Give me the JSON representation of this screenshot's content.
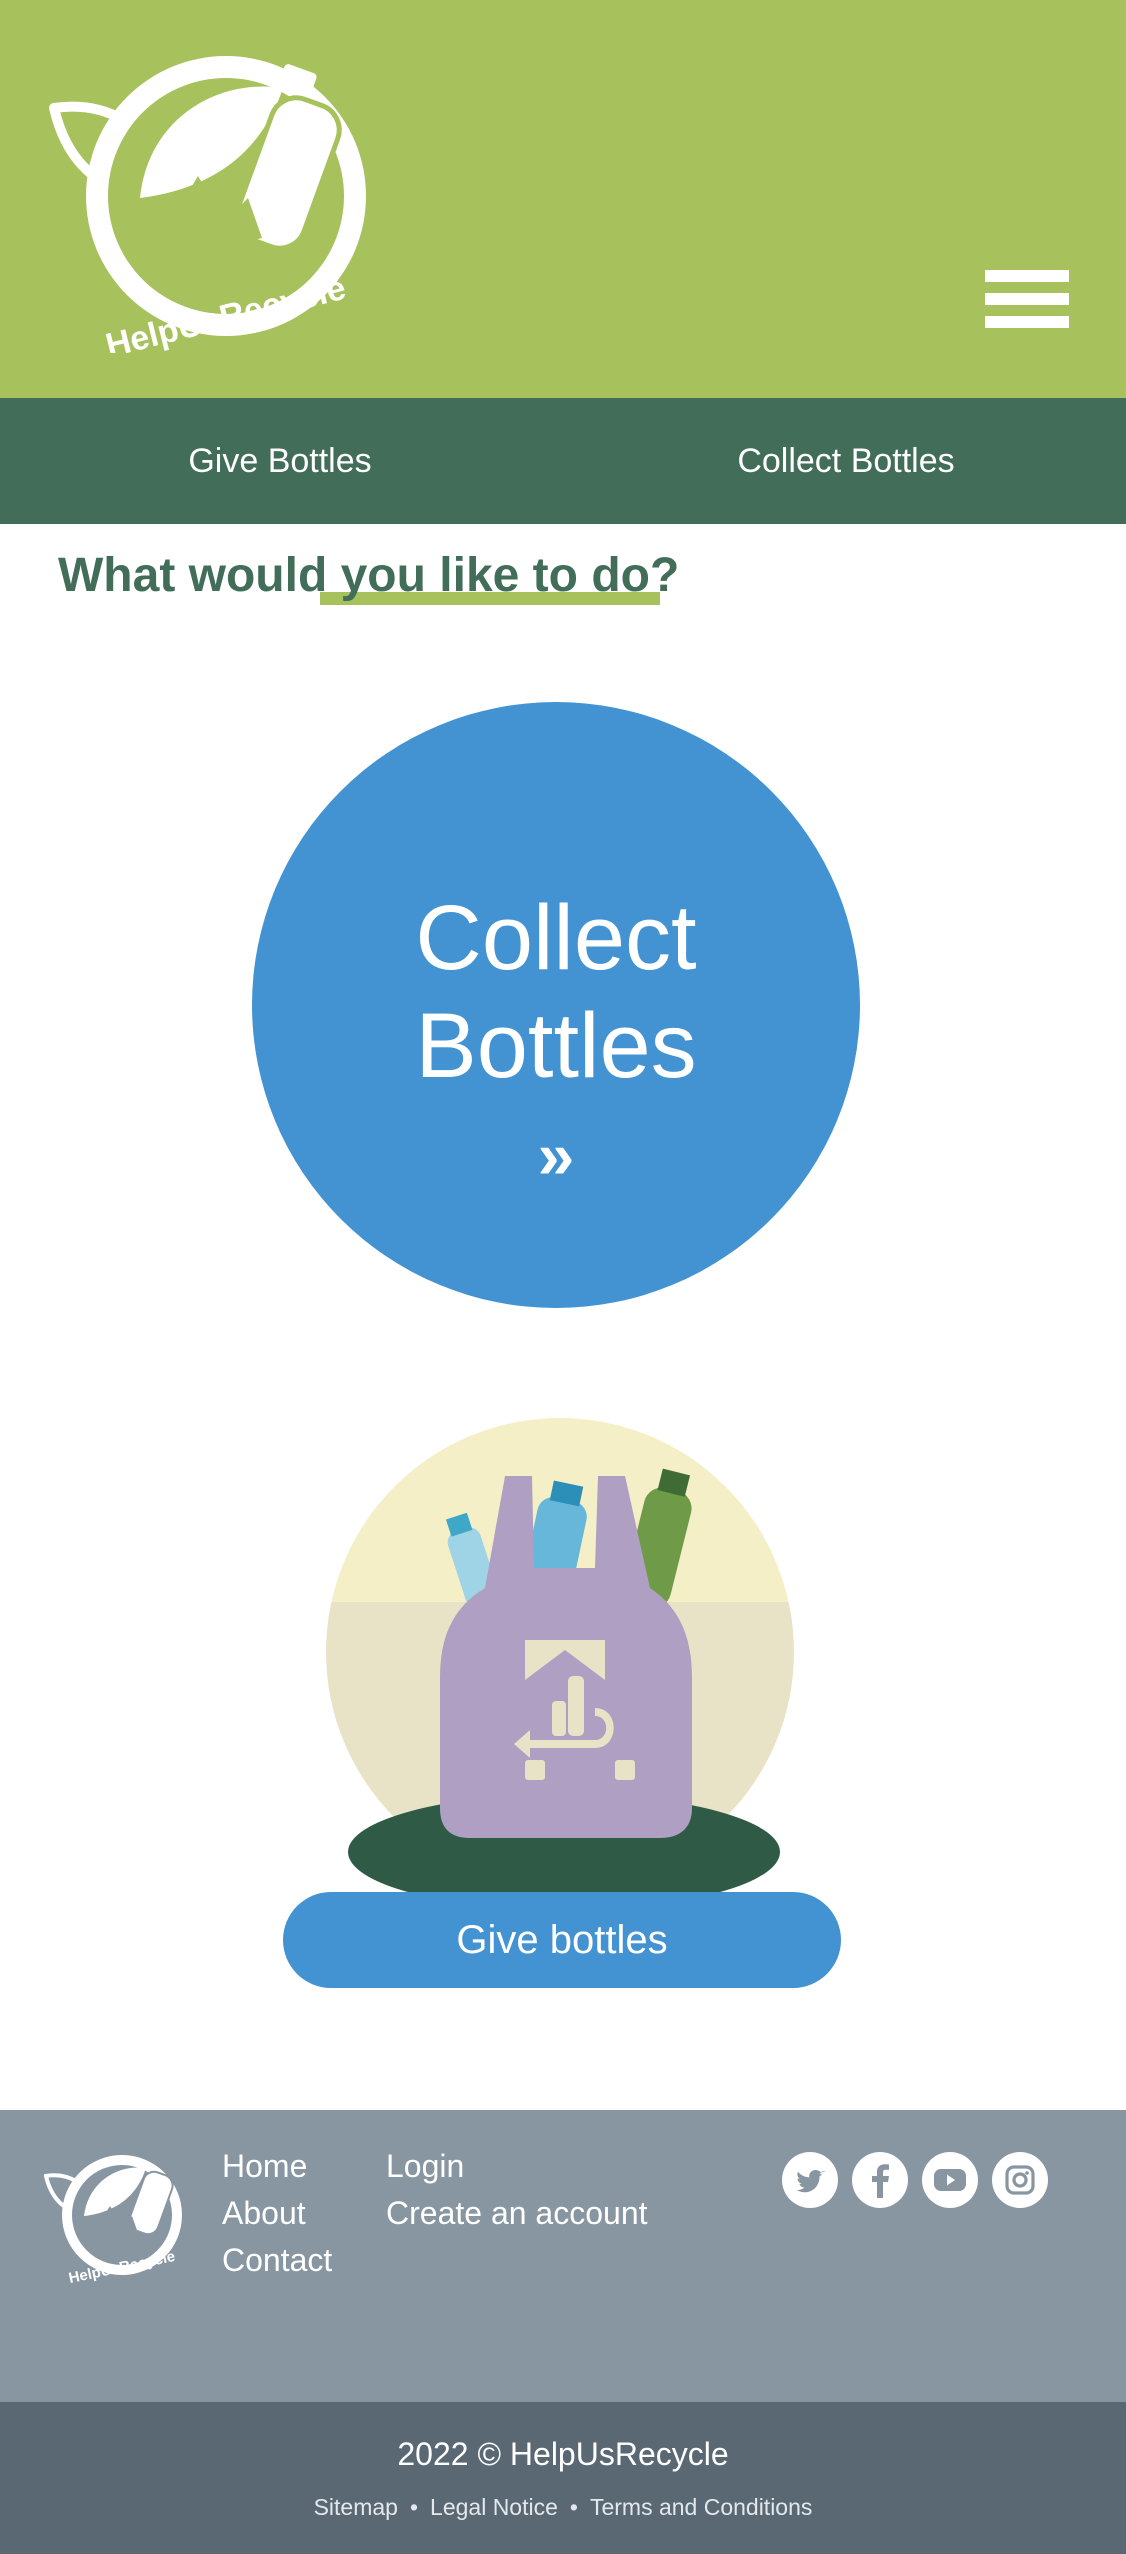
{
  "header": {
    "logo_text": "HelpUsRecycle",
    "menu_icon": "hamburger-menu-icon"
  },
  "nav": {
    "give_label": "Give Bottles",
    "collect_label": "Collect Bottles"
  },
  "main": {
    "question": "What would you like to do?",
    "collect_line1": "Collect",
    "collect_line2": "Bottles",
    "collect_chevron": "»",
    "give_button_label": "Give bottles"
  },
  "footer": {
    "logo_text": "HelpUsRecycle",
    "links_col1": [
      "Home",
      "About",
      "Contact"
    ],
    "links_col2": [
      "Login",
      "Create an account"
    ],
    "social_icons": [
      "twitter-icon",
      "facebook-icon",
      "youtube-icon",
      "instagram-icon"
    ],
    "copyright": "2022 © HelpUsRecycle",
    "legal_links": [
      "Sitemap",
      "Legal Notice",
      "Terms and Conditions"
    ],
    "legal_separator": "•"
  },
  "colors": {
    "header_green": "#a7c25c",
    "nav_dark_green": "#426d59",
    "accent_blue": "#4393d2",
    "footer_gray": "#8896a1",
    "bottom_bar": "#5a6874",
    "bag_purple": "#ae9fc3"
  }
}
